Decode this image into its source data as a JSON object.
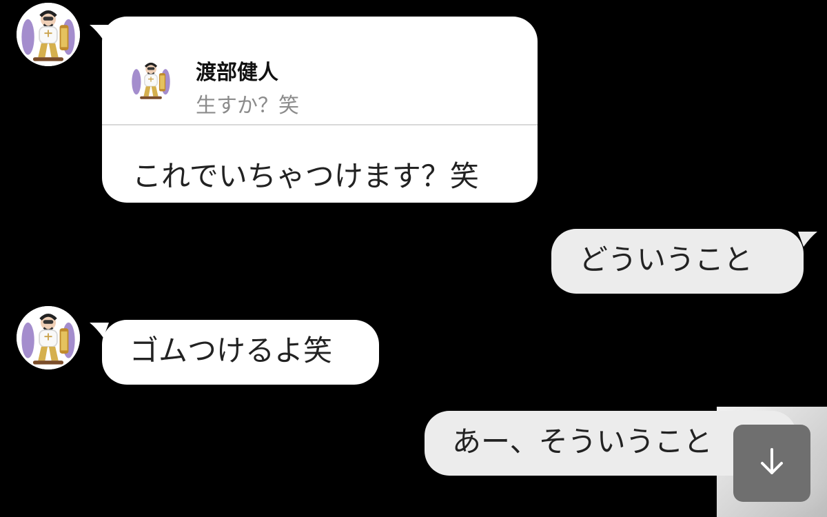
{
  "chat": {
    "messages": [
      {
        "sender": "渡部健人",
        "reply_to": {
          "name": "渡部健人",
          "snippet": "生すか？笑"
        },
        "text": "これでいちゃつけます？笑"
      },
      {
        "sender": "me",
        "text": "どういうこと"
      },
      {
        "sender": "渡部健人",
        "text": "ゴムつけるよ笑"
      },
      {
        "sender": "me",
        "text": "あー、そういうこと"
      }
    ]
  },
  "ui": {
    "scroll_button_icon": "arrow-down-icon"
  },
  "colors": {
    "background": "#000000",
    "incoming_bubble": "#ffffff",
    "outgoing_bubble": "#ececec",
    "scroll_button": "#6f6f6f",
    "avatar_accent": "#6b4ca3"
  }
}
